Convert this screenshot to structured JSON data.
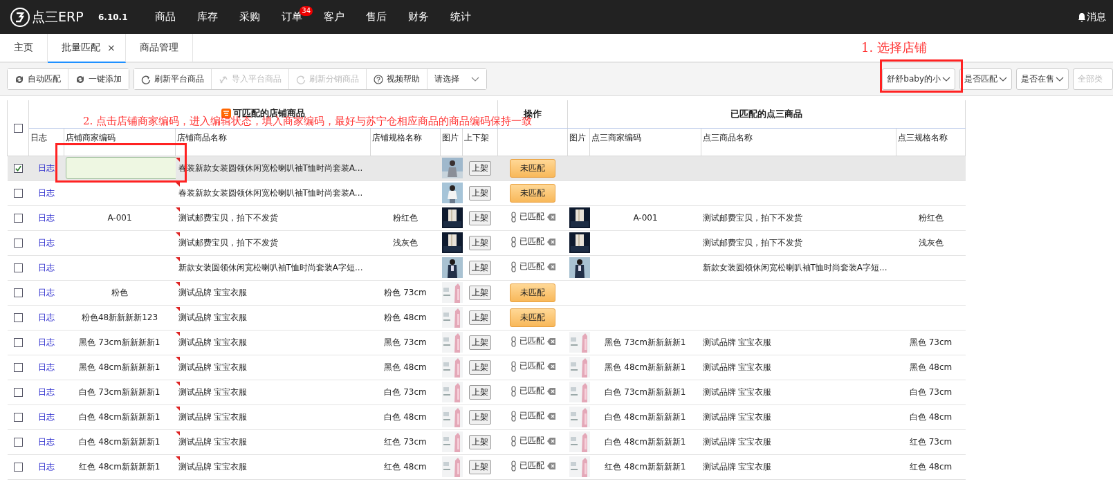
{
  "nav": {
    "logo": "点三ERP",
    "version": "6.10.1",
    "menu": [
      {
        "label": "商品"
      },
      {
        "label": "库存"
      },
      {
        "label": "采购"
      },
      {
        "label": "订单",
        "badge": "34"
      },
      {
        "label": "客户"
      },
      {
        "label": "售后"
      },
      {
        "label": "财务"
      },
      {
        "label": "统计"
      }
    ],
    "messages": "消息"
  },
  "tabs": [
    {
      "label": "主页",
      "selected": false,
      "closable": false
    },
    {
      "label": "批量匹配",
      "selected": true,
      "closable": true,
      "close": "×"
    },
    {
      "label": "商品管理",
      "selected": false,
      "closable": false
    }
  ],
  "toolbar": {
    "groups": [
      [
        {
          "label": "自动匹配",
          "kind": "sync",
          "disabled": false
        },
        {
          "label": "一键添加",
          "kind": "sync",
          "disabled": false
        }
      ],
      [
        {
          "label": "刷新平台商品",
          "kind": "refresh",
          "disabled": false
        },
        {
          "label": "导入平台商品",
          "kind": "import",
          "disabled": true
        },
        {
          "label": "刷新分销商品",
          "kind": "refresh",
          "disabled": true
        },
        {
          "label": "视频帮助",
          "kind": "help",
          "disabled": false
        },
        {
          "label": "请选择",
          "kind": "dropdown",
          "disabled": false
        }
      ]
    ],
    "filters": [
      {
        "label": "舒舒baby的小",
        "disabled": false
      },
      {
        "label": "是否匹配",
        "disabled": false
      },
      {
        "label": "是否在售",
        "disabled": false
      },
      {
        "label": "全部类",
        "disabled": true
      }
    ]
  },
  "annotations": [
    {
      "kind": "select-store",
      "text": "1. 选择店铺"
    },
    {
      "kind": "edit-code",
      "text": "2. 点击店铺商家编码，进入编辑状态，填入商家编码，最好与苏宁仓相应商品的商品编码保持一致"
    }
  ],
  "table": {
    "select_all_checked": false,
    "groups": [
      "可匹配的店铺商品",
      "操作",
      "已匹配的点三商品"
    ],
    "columns": [
      "日志",
      "店铺商家编码",
      "店铺商品名称",
      "店铺规格名称",
      "图片",
      "上下架",
      "图片",
      "点三商家编码",
      "点三商品名称",
      "点三规格名称"
    ],
    "rows": [
      {
        "checked": true,
        "log": "日志",
        "editing": true,
        "name": "春装新款女装圆领休闲宽松喇叭袖T恤时尚套装A...",
        "listing": "上架",
        "match": {
          "kind": "unmatched",
          "label": "未匹配"
        }
      },
      {
        "checked": false,
        "log": "日志",
        "editing": false,
        "name": "春装新款女装圆领休闲宽松喇叭袖T恤时尚套装A...",
        "listing": "上架",
        "match": {
          "kind": "unmatched",
          "label": "未匹配"
        }
      },
      {
        "checked": false,
        "log": "日志",
        "editing": false,
        "code": "A-001",
        "name": "测试邮费宝贝，拍下不发货",
        "spec": "粉红色",
        "listing": "上架",
        "match": {
          "kind": "matched",
          "label": "已匹配"
        },
        "matched": {
          "code": "A-001",
          "name": "测试邮费宝贝，拍下不发货",
          "spec": "粉红色"
        }
      },
      {
        "checked": false,
        "log": "日志",
        "editing": false,
        "name": "测试邮费宝贝，拍下不发货",
        "spec": "浅灰色",
        "listing": "上架",
        "match": {
          "kind": "matched",
          "label": "已匹配"
        },
        "matched": {
          "name": "测试邮费宝贝，拍下不发货",
          "spec": "浅灰色"
        }
      },
      {
        "checked": false,
        "log": "日志",
        "editing": false,
        "name": "新款女装圆领休闲宽松喇叭袖T恤时尚套装A字短...",
        "listing": "上架",
        "match": {
          "kind": "matched",
          "label": "已匹配"
        },
        "matched": {
          "name": "新款女装圆领休闲宽松喇叭袖T恤时尚套装A字短..."
        }
      },
      {
        "checked": false,
        "log": "日志",
        "editing": false,
        "code": "粉色",
        "name": "测试品牌 宝宝衣服",
        "spec": "粉色 73cm",
        "listing": "上架",
        "match": {
          "kind": "unmatched",
          "label": "未匹配"
        }
      },
      {
        "checked": false,
        "log": "日志",
        "editing": false,
        "code": "粉色48新新新新123",
        "name": "测试品牌 宝宝衣服",
        "spec": "粉色 48cm",
        "listing": "上架",
        "match": {
          "kind": "unmatched",
          "label": "未匹配"
        }
      },
      {
        "checked": false,
        "log": "日志",
        "editing": false,
        "code": "黑色 73cm新新新新1",
        "name": "测试品牌 宝宝衣服",
        "spec": "黑色 73cm",
        "listing": "上架",
        "match": {
          "kind": "matched",
          "label": "已匹配"
        },
        "matched": {
          "code": "黑色 73cm新新新新1",
          "name": "测试品牌 宝宝衣服",
          "spec": "黑色 73cm"
        }
      },
      {
        "checked": false,
        "log": "日志",
        "editing": false,
        "code": "黑色 48cm新新新新1",
        "name": "测试品牌 宝宝衣服",
        "spec": "黑色 48cm",
        "listing": "上架",
        "match": {
          "kind": "matched",
          "label": "已匹配"
        },
        "matched": {
          "code": "黑色 48cm新新新新1",
          "name": "测试品牌 宝宝衣服",
          "spec": "黑色 48cm"
        }
      },
      {
        "checked": false,
        "log": "日志",
        "editing": false,
        "code": "白色 73cm新新新新1",
        "name": "测试品牌 宝宝衣服",
        "spec": "白色 73cm",
        "listing": "上架",
        "match": {
          "kind": "matched",
          "label": "已匹配"
        },
        "matched": {
          "code": "白色 73cm新新新新1",
          "name": "测试品牌 宝宝衣服",
          "spec": "白色 73cm"
        }
      },
      {
        "checked": false,
        "log": "日志",
        "editing": false,
        "code": "白色 48cm新新新新1",
        "name": "测试品牌 宝宝衣服",
        "spec": "白色 48cm",
        "listing": "上架",
        "match": {
          "kind": "matched",
          "label": "已匹配"
        },
        "matched": {
          "code": "白色 48cm新新新新1",
          "name": "测试品牌 宝宝衣服",
          "spec": "白色 48cm"
        }
      },
      {
        "checked": false,
        "log": "日志",
        "editing": false,
        "code": "白色 48cm新新新新1",
        "name": "测试品牌 宝宝衣服",
        "spec": "红色 73cm",
        "listing": "上架",
        "match": {
          "kind": "matched",
          "label": "已匹配"
        },
        "matched": {
          "code": "白色 48cm新新新新1",
          "name": "测试品牌 宝宝衣服",
          "spec": "红色 73cm"
        }
      },
      {
        "checked": false,
        "log": "日志",
        "editing": false,
        "code": "红色 48cm新新新新1",
        "name": "测试品牌 宝宝衣服",
        "spec": "红色 48cm",
        "listing": "上架",
        "match": {
          "kind": "matched",
          "label": "已匹配"
        },
        "matched": {
          "code": "红色 48cm新新新新1",
          "name": "测试品牌 宝宝衣服",
          "spec": "红色 48cm"
        }
      }
    ]
  }
}
